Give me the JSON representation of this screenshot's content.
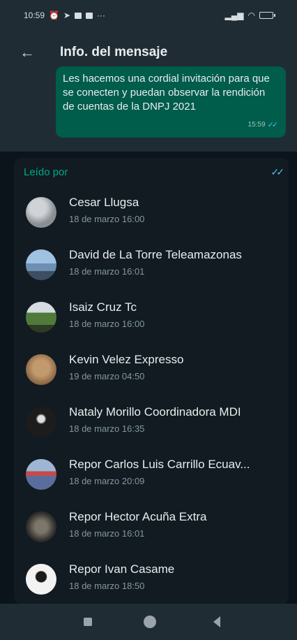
{
  "status_bar": {
    "time": "10:59",
    "more": "···"
  },
  "header": {
    "title": "Info. del mensaje"
  },
  "message": {
    "text": "Les hacemos una cordial invitación para que se conecten y puedan observar la rendición de cuentas de la DNPJ 2021",
    "time": "15:59"
  },
  "read_by": {
    "label": "Leído por",
    "contacts": [
      {
        "name": "Cesar Llugsa",
        "date": "18 de marzo 16:00",
        "avatar_color": "#8a8f94"
      },
      {
        "name": "David de La Torre Teleamazonas",
        "date": "18 de marzo 16:01",
        "avatar_color": "#6d8fb3"
      },
      {
        "name": "Isaiz Cruz Tc",
        "date": "18 de marzo 16:00",
        "avatar_color": "#4f7a3a"
      },
      {
        "name": "Kevin Velez Expresso",
        "date": "19 de marzo 04:50",
        "avatar_color": "#a07a55"
      },
      {
        "name": "Nataly Morillo Coordinadora MDI",
        "date": "18 de marzo 16:35",
        "avatar_color": "#2a2a2a"
      },
      {
        "name": "Repor Carlos Luis Carrillo Ecuav...",
        "date": "18 de marzo 20:09",
        "avatar_color": "#5a6e9e"
      },
      {
        "name": "Repor Hector Acuña Extra",
        "date": "18 de marzo 16:01",
        "avatar_color": "#3b3a36"
      },
      {
        "name": "Repor Ivan Casame",
        "date": "18 de marzo 18:50",
        "avatar_color": "#d8d8d8"
      }
    ]
  }
}
